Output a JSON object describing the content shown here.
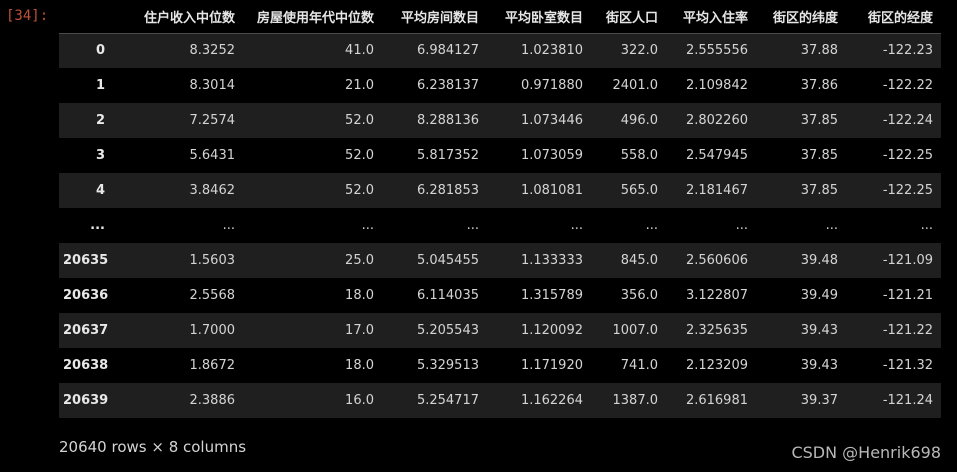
{
  "cell": {
    "prompt": "[34]:"
  },
  "table": {
    "columns": [
      "",
      "住户收入中位数",
      "房屋使用年代中位数",
      "平均房间数目",
      "平均卧室数目",
      "街区人口",
      "平均入住率",
      "街区的纬度",
      "街区的经度"
    ],
    "rows": [
      [
        "0",
        "8.3252",
        "41.0",
        "6.984127",
        "1.023810",
        "322.0",
        "2.555556",
        "37.88",
        "-122.23"
      ],
      [
        "1",
        "8.3014",
        "21.0",
        "6.238137",
        "0.971880",
        "2401.0",
        "2.109842",
        "37.86",
        "-122.22"
      ],
      [
        "2",
        "7.2574",
        "52.0",
        "8.288136",
        "1.073446",
        "496.0",
        "2.802260",
        "37.85",
        "-122.24"
      ],
      [
        "3",
        "5.6431",
        "52.0",
        "5.817352",
        "1.073059",
        "558.0",
        "2.547945",
        "37.85",
        "-122.25"
      ],
      [
        "4",
        "3.8462",
        "52.0",
        "6.281853",
        "1.081081",
        "565.0",
        "2.181467",
        "37.85",
        "-122.25"
      ],
      [
        "...",
        "...",
        "...",
        "...",
        "...",
        "...",
        "...",
        "...",
        "..."
      ],
      [
        "20635",
        "1.5603",
        "25.0",
        "5.045455",
        "1.133333",
        "845.0",
        "2.560606",
        "39.48",
        "-121.09"
      ],
      [
        "20636",
        "2.5568",
        "18.0",
        "6.114035",
        "1.315789",
        "356.0",
        "3.122807",
        "39.49",
        "-121.21"
      ],
      [
        "20637",
        "1.7000",
        "17.0",
        "5.205543",
        "1.120092",
        "1007.0",
        "2.325635",
        "39.43",
        "-121.22"
      ],
      [
        "20638",
        "1.8672",
        "18.0",
        "5.329513",
        "1.171920",
        "741.0",
        "2.123209",
        "39.43",
        "-121.32"
      ],
      [
        "20639",
        "2.3886",
        "16.0",
        "5.254717",
        "1.162264",
        "1387.0",
        "2.616981",
        "39.37",
        "-121.24"
      ]
    ]
  },
  "footer": {
    "shape": "20640 rows × 8 columns"
  },
  "watermark": {
    "text": "CSDN @Henrik698"
  }
}
